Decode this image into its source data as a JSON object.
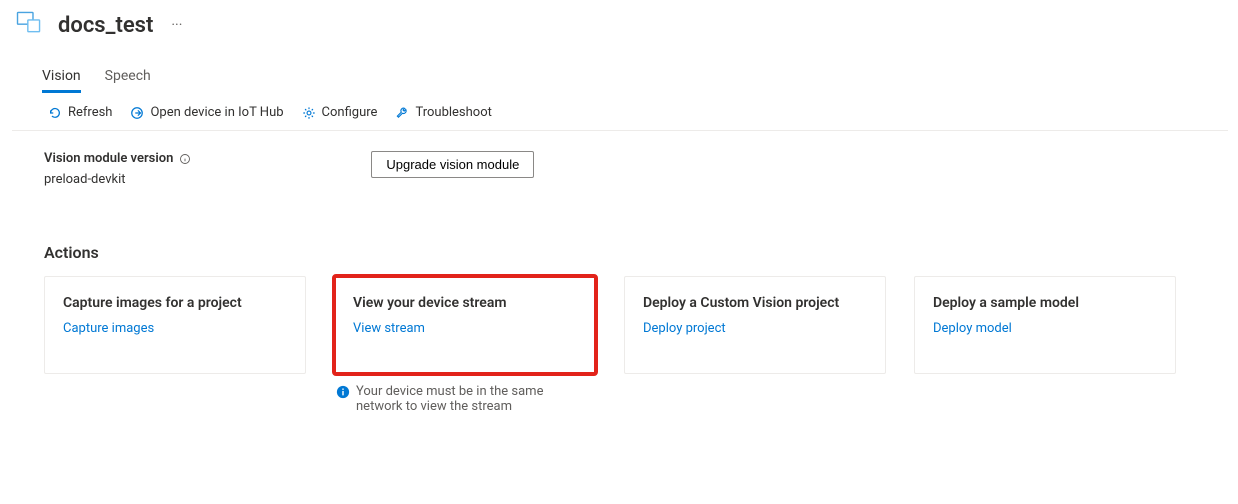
{
  "header": {
    "title": "docs_test",
    "more_label": "···"
  },
  "tabs": [
    {
      "label": "Vision",
      "active": true
    },
    {
      "label": "Speech",
      "active": false
    }
  ],
  "toolbar": {
    "refresh": "Refresh",
    "open_iot": "Open device in IoT Hub",
    "configure": "Configure",
    "troubleshoot": "Troubleshoot"
  },
  "version": {
    "label": "Vision module version",
    "value": "preload-devkit",
    "upgrade_button": "Upgrade vision module"
  },
  "actions_heading": "Actions",
  "actions": [
    {
      "title": "Capture images for a project",
      "link": "Capture images"
    },
    {
      "title": "View your device stream",
      "link": "View stream",
      "highlight": true,
      "note": "Your device must be in the same network to view the stream"
    },
    {
      "title": "Deploy a Custom Vision project",
      "link": "Deploy project"
    },
    {
      "title": "Deploy a sample model",
      "link": "Deploy model"
    }
  ]
}
